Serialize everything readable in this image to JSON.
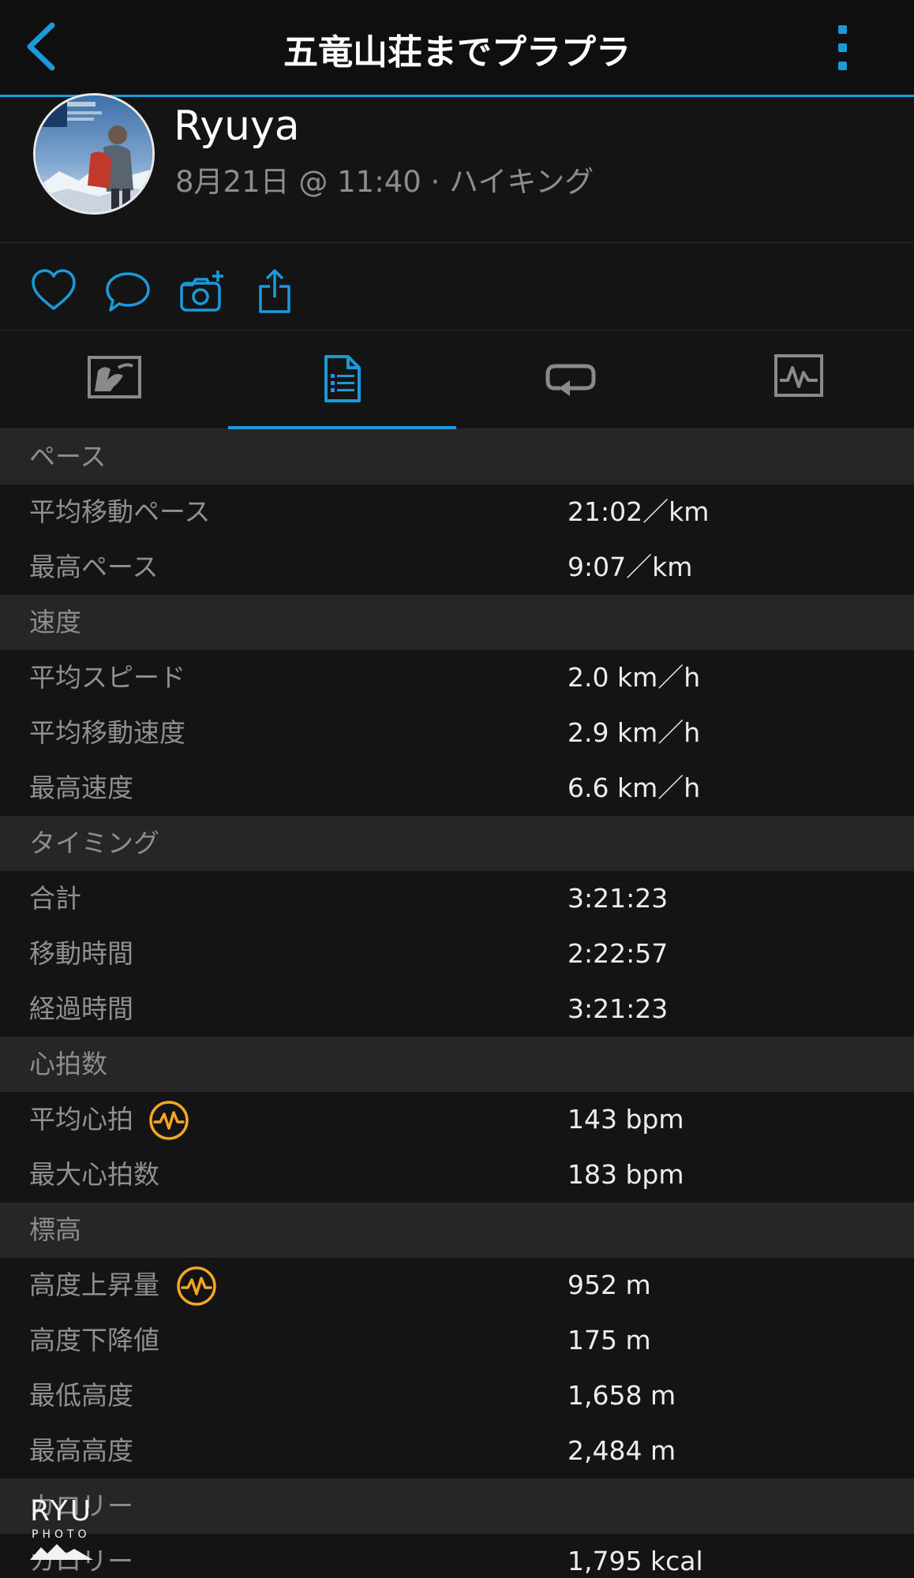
{
  "header": {
    "title": "五竜山荘までプラプラ"
  },
  "profile": {
    "name": "Ryuya",
    "subtitle": "8月21日 @ 11:40 · ハイキング"
  },
  "colors": {
    "accent": "#1a9ad8",
    "heart_rate_badge": "#f5a623",
    "background": "#141414",
    "section_header": "#262626"
  },
  "actions": [
    "heart-icon",
    "comment-icon",
    "add-photo-icon",
    "share-icon"
  ],
  "tabs": [
    {
      "icon": "map-icon",
      "active": false
    },
    {
      "icon": "document-icon",
      "active": true
    },
    {
      "icon": "laps-icon",
      "active": false
    },
    {
      "icon": "chart-icon",
      "active": false
    }
  ],
  "sections": [
    {
      "title": "ペース",
      "rows": [
        {
          "label": "平均移動ペース",
          "value": "21:02／km"
        },
        {
          "label": "最高ペース",
          "value": "9:07／km"
        }
      ]
    },
    {
      "title": "速度",
      "rows": [
        {
          "label": "平均スピード",
          "value": "2.0 km／h"
        },
        {
          "label": "平均移動速度",
          "value": "2.9 km／h"
        },
        {
          "label": "最高速度",
          "value": "6.6 km／h"
        }
      ]
    },
    {
      "title": "タイミング",
      "rows": [
        {
          "label": "合計",
          "value": "3:21:23"
        },
        {
          "label": "移動時間",
          "value": "2:22:57"
        },
        {
          "label": "経過時間",
          "value": "3:21:23"
        }
      ]
    },
    {
      "title": "心拍数",
      "rows": [
        {
          "label": "平均心拍",
          "value": "143 bpm"
        },
        {
          "label": "最大心拍数",
          "value": "183 bpm"
        }
      ]
    },
    {
      "title": "標高",
      "rows": [
        {
          "label": "高度上昇量",
          "value": "952 m"
        },
        {
          "label": "高度下降値",
          "value": "175 m"
        },
        {
          "label": "最低高度",
          "value": "1,658 m"
        },
        {
          "label": "最高高度",
          "value": "2,484 m"
        }
      ]
    },
    {
      "title": "カロリー",
      "rows": [
        {
          "label": "カロリー",
          "value": "1,795 kcal"
        }
      ]
    }
  ],
  "watermark": {
    "line1": "RYU",
    "line2": "PHOTO"
  }
}
